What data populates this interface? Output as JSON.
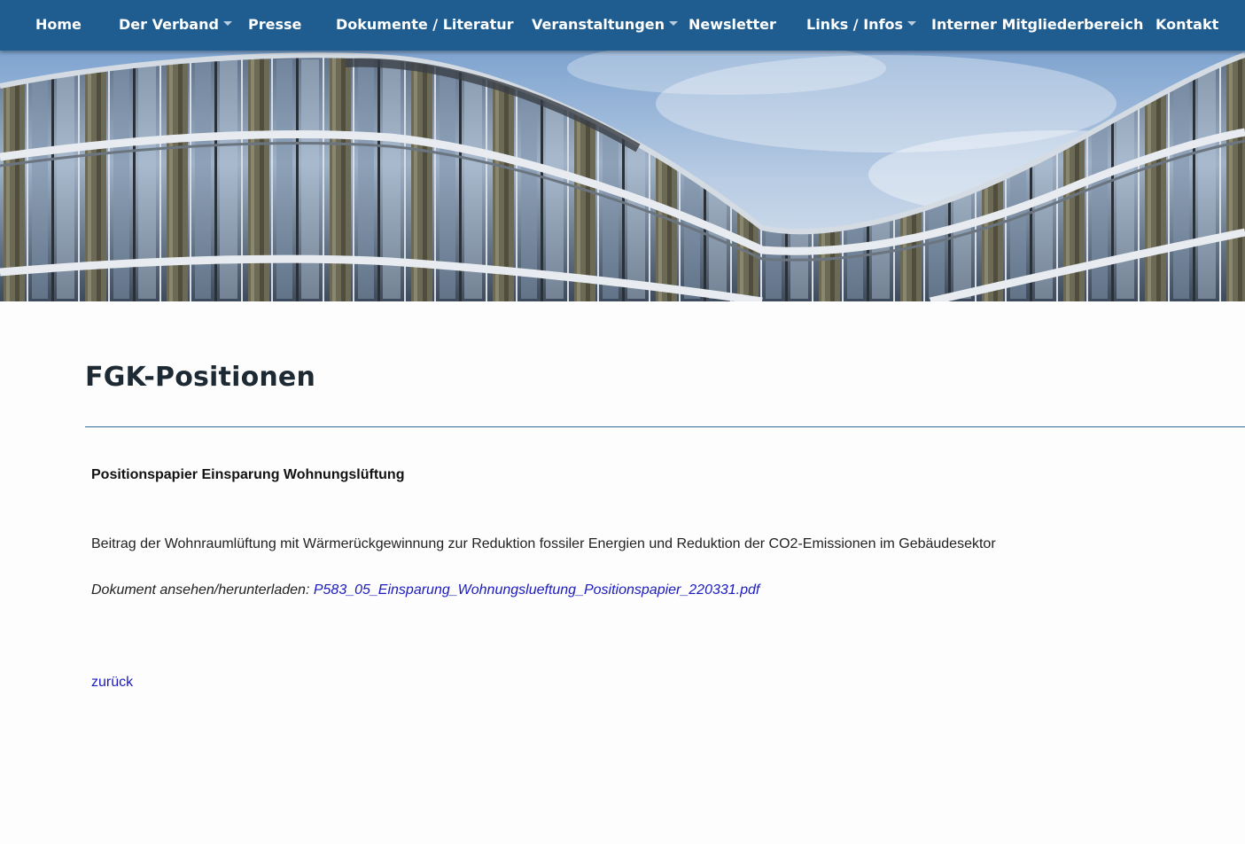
{
  "nav": {
    "items": [
      {
        "label": "Home",
        "has_dropdown": false
      },
      {
        "label": "Der Verband",
        "has_dropdown": true
      },
      {
        "label": "Presse",
        "has_dropdown": false
      },
      {
        "label": "Dokumente / Literatur",
        "has_dropdown": false
      },
      {
        "label": "Veranstaltungen",
        "has_dropdown": true
      },
      {
        "label": "Newsletter",
        "has_dropdown": false
      },
      {
        "label": "Links / Infos",
        "has_dropdown": true
      },
      {
        "label": "Interner Mitgliederbereich",
        "has_dropdown": false
      },
      {
        "label": "Kontakt",
        "has_dropdown": false
      }
    ]
  },
  "hero": {
    "image": "curved-glass-office-building-facade"
  },
  "page": {
    "title": "FGK-Positionen"
  },
  "document": {
    "heading": "Positionspapier Einsparung Wohnungslüftung",
    "description": "Beitrag der Wohnraumlüftung mit Wärmerückgewinnung zur Reduktion fossiler Energien und Reduktion der CO2-Emissionen im Gebäudesektor",
    "download_prefix": "Dokument ansehen/herunterladen: ",
    "download_filename": "P583_05_Einsparung_Wohnungslueftung_Positionspapier_220331.pdf"
  },
  "back_link": "zurück",
  "colors": {
    "nav_bg": "#1f5c8f",
    "link": "#1a1abf",
    "rule": "#2e6a94",
    "title": "#1e2a33"
  }
}
